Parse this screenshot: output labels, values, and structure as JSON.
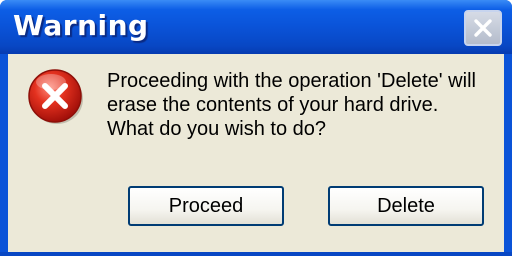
{
  "dialog": {
    "title": "Warning",
    "icon": "error-icon",
    "message_lines": [
      "Proceeding with the operation 'Delete' will",
      "erase the contents of your hard drive.",
      "What do you wish to do?"
    ],
    "buttons": {
      "proceed_label": "Proceed",
      "delete_label": "Delete"
    },
    "close_icon": "close-icon"
  },
  "colors": {
    "titlebar": "#0a53d8",
    "client_background": "#ece9d8",
    "icon_red": "#d8261c",
    "button_border": "#003c74"
  }
}
